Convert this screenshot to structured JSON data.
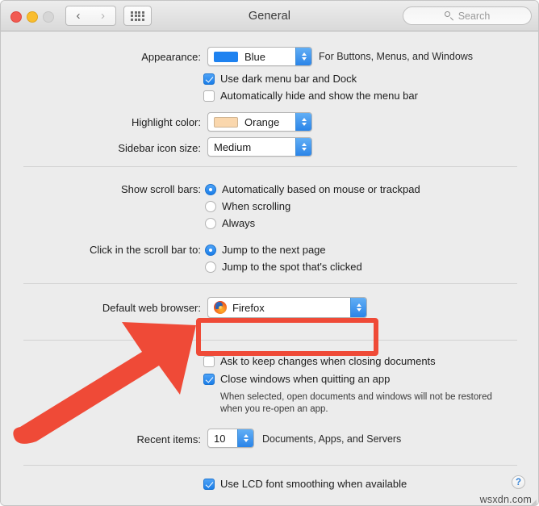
{
  "window": {
    "title": "General",
    "search_placeholder": "Search",
    "traffic_lights": [
      "close",
      "minimize",
      "zoom"
    ],
    "nav": {
      "back": "‹",
      "forward": "›"
    }
  },
  "appearance": {
    "label": "Appearance:",
    "value": "Blue",
    "swatch_color": "#1e82f0",
    "helper": "For Buttons, Menus, and Windows",
    "dark_menu_bar": {
      "label": "Use dark menu bar and Dock",
      "checked": true
    },
    "auto_hide_menu_bar": {
      "label": "Automatically hide and show the menu bar",
      "checked": false
    }
  },
  "highlight": {
    "label": "Highlight color:",
    "value": "Orange",
    "swatch_color": "#fad7ad"
  },
  "sidebar_icon": {
    "label": "Sidebar icon size:",
    "value": "Medium"
  },
  "scroll_bars": {
    "label": "Show scroll bars:",
    "options": [
      {
        "label": "Automatically based on mouse or trackpad",
        "selected": true
      },
      {
        "label": "When scrolling",
        "selected": false
      },
      {
        "label": "Always",
        "selected": false
      }
    ]
  },
  "scroll_click": {
    "label": "Click in the scroll bar to:",
    "options": [
      {
        "label": "Jump to the next page",
        "selected": true
      },
      {
        "label": "Jump to the spot that's clicked",
        "selected": false
      }
    ]
  },
  "default_browser": {
    "label": "Default web browser:",
    "value": "Firefox",
    "icon": "firefox-icon",
    "highlight_color": "#ef4a37"
  },
  "documents": {
    "ask_keep_changes": {
      "label": "Ask to keep changes when closing documents",
      "checked": false
    },
    "close_windows": {
      "label": "Close windows when quitting an app",
      "checked": true
    },
    "note_line1": "When selected, open documents and windows will not be restored",
    "note_line2": "when you re-open an app."
  },
  "recent_items": {
    "label": "Recent items:",
    "value": "10",
    "helper": "Documents, Apps, and Servers"
  },
  "font_smoothing": {
    "label": "Use LCD font smoothing when available",
    "checked": true
  },
  "help": {
    "glyph": "?"
  },
  "watermark": "wsxdn.com"
}
